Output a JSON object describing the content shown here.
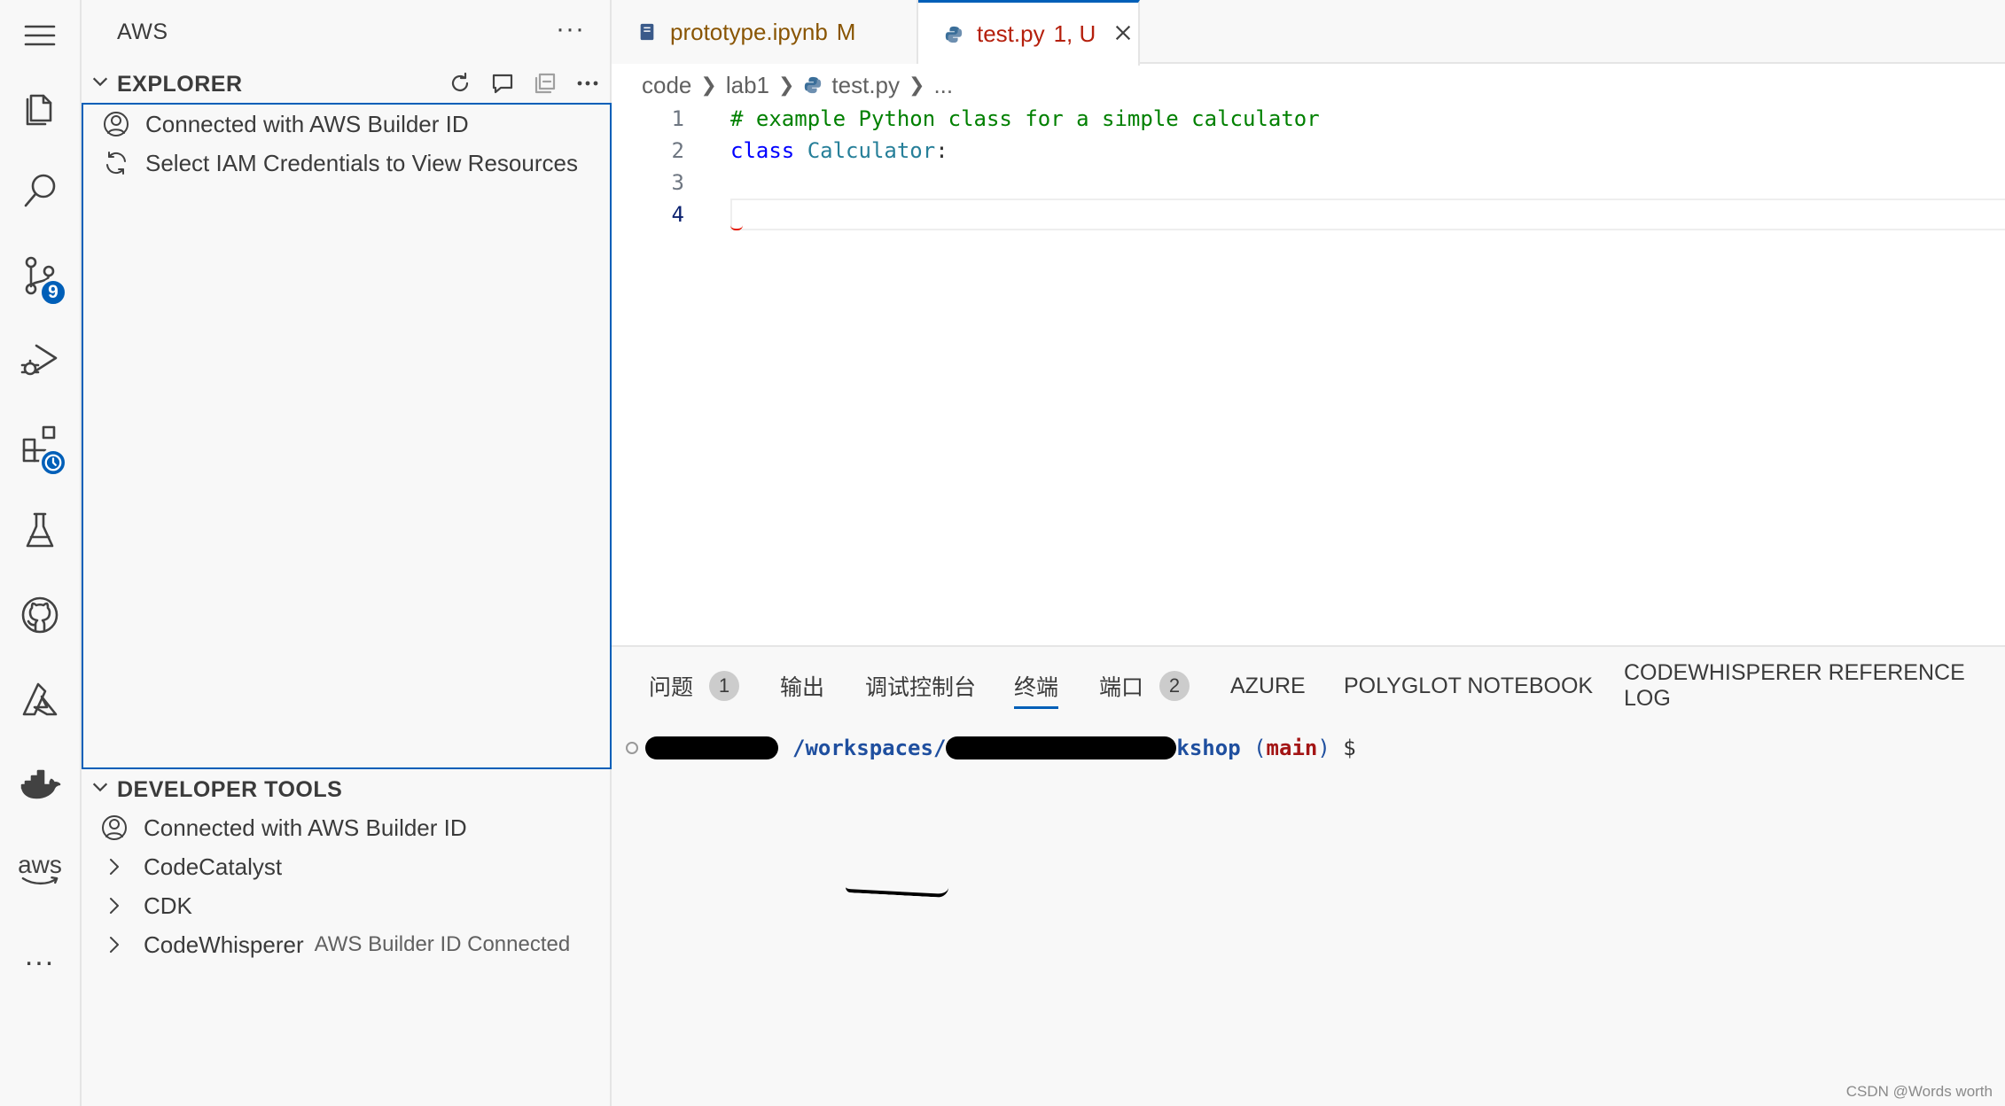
{
  "activity_bar": {
    "items": [
      {
        "name": "menu-icon"
      },
      {
        "name": "explorer-files-icon"
      },
      {
        "name": "search-icon"
      },
      {
        "name": "source-control-icon",
        "badge": "9"
      },
      {
        "name": "run-debug-icon"
      },
      {
        "name": "extensions-icon"
      },
      {
        "name": "testing-flask-icon"
      },
      {
        "name": "github-icon"
      },
      {
        "name": "azure-icon"
      },
      {
        "name": "docker-icon"
      },
      {
        "name": "aws-icon",
        "label": "aws"
      },
      {
        "name": "more-icon",
        "label": "..."
      }
    ]
  },
  "sidebar": {
    "title": "AWS",
    "more": "···",
    "explorer": {
      "label": "EXPLORER",
      "items": [
        {
          "icon": "account-icon",
          "text": "Connected with AWS Builder ID"
        },
        {
          "icon": "sync-icon",
          "text": "Select IAM Credentials to View Resources"
        }
      ]
    },
    "developer_tools": {
      "label": "DEVELOPER TOOLS",
      "items": [
        {
          "icon": "account-icon",
          "text": "Connected with AWS Builder ID"
        },
        {
          "icon": "chevron-right-icon",
          "text": "CodeCatalyst"
        },
        {
          "icon": "chevron-right-icon",
          "text": "CDK"
        },
        {
          "icon": "chevron-right-icon",
          "text": "CodeWhisperer",
          "desc": "AWS Builder ID Connected"
        }
      ]
    }
  },
  "tabs": [
    {
      "name": "prototype.ipynb",
      "status": "M",
      "color": "#895503"
    },
    {
      "name": "test.py",
      "status": "1, U",
      "color": "#b5200d"
    }
  ],
  "breadcrumb": [
    "code",
    "lab1",
    "test.py",
    "..."
  ],
  "code": {
    "line_numbers": [
      "1",
      "2",
      "3",
      "4"
    ],
    "line1": "# example Python class for a simple calculator",
    "line2_kw": "class",
    "line2_cls": "Calculator",
    "line2_end": ":"
  },
  "panel": {
    "tabs": [
      {
        "label": "问题",
        "count": "1"
      },
      {
        "label": "输出"
      },
      {
        "label": "调试控制台"
      },
      {
        "label": "终端",
        "active": true
      },
      {
        "label": "端口",
        "count": "2"
      },
      {
        "label": "AZURE"
      },
      {
        "label": "POLYGLOT NOTEBOOK"
      },
      {
        "label": "CODEWHISPERER REFERENCE LOG"
      }
    ],
    "terminal": {
      "path_prefix": "/workspaces/",
      "path_suffix": "kshop",
      "branch_open": " (",
      "branch": "main",
      "branch_close": ")",
      "dollar": " $"
    }
  },
  "watermark": "CSDN @Words worth",
  "colors": {
    "accent": "#005fb8",
    "modified": "#895503",
    "error": "#b5200d"
  }
}
